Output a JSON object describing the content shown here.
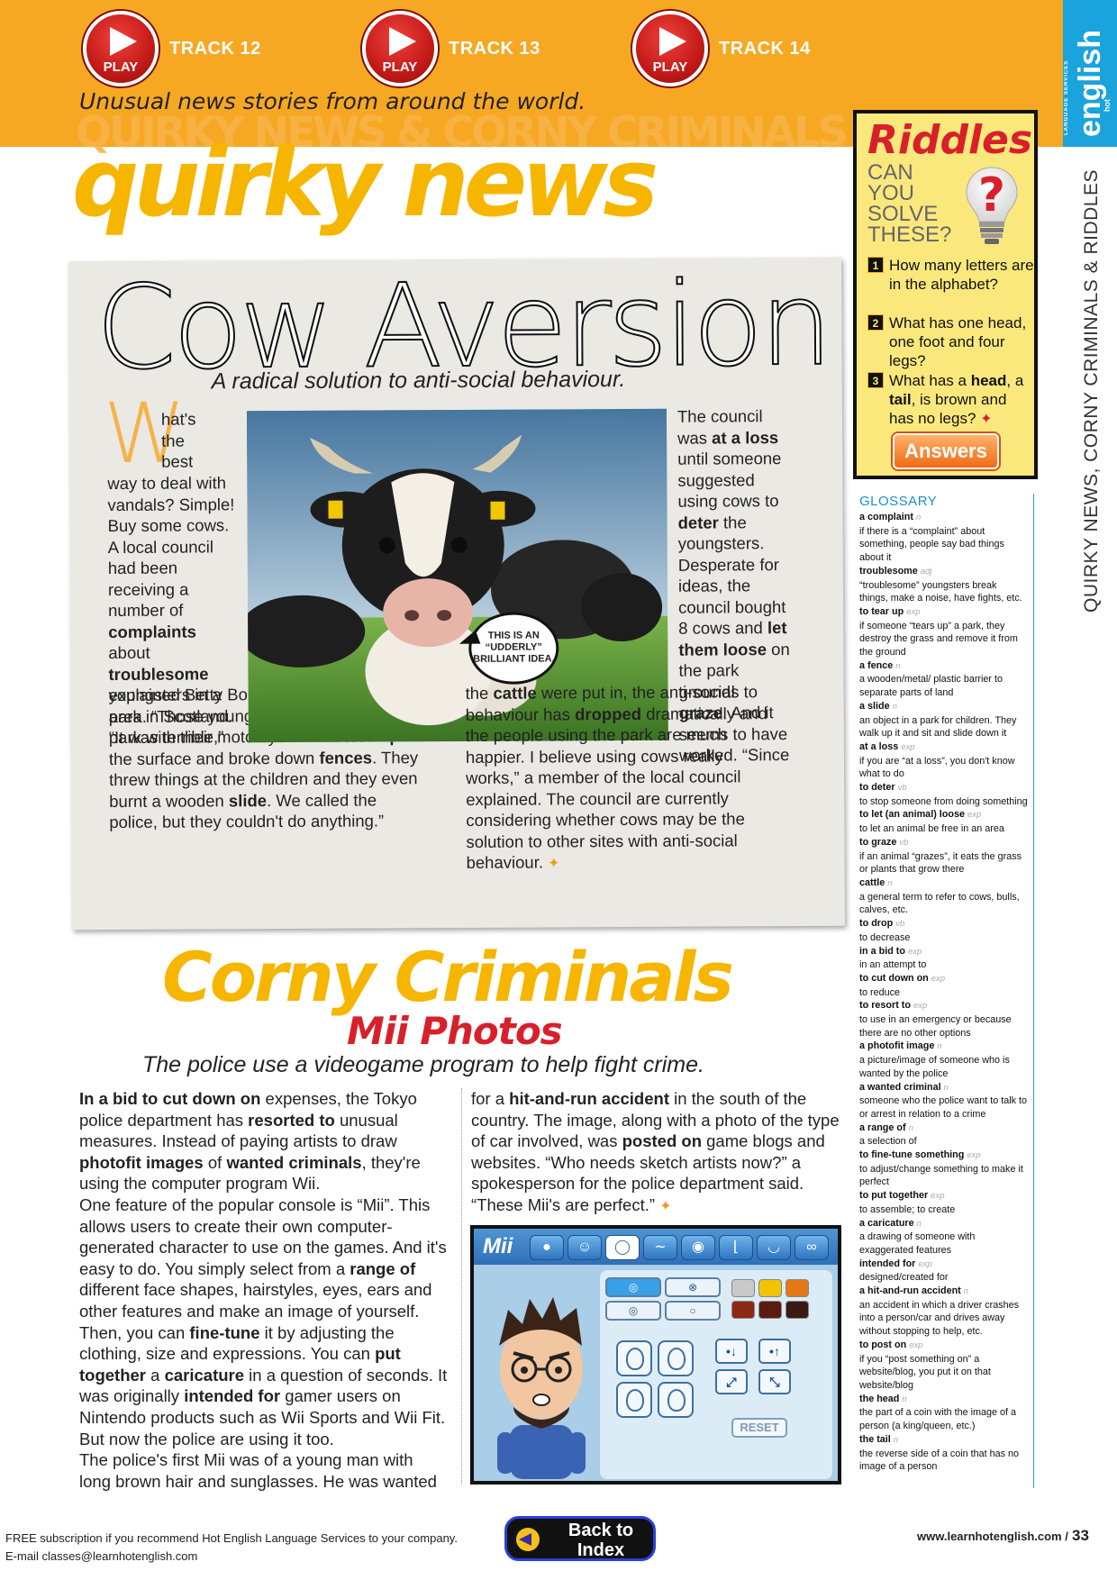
{
  "header": {
    "tracks": [
      {
        "play_label": "PLAY",
        "label": "TRACK 12"
      },
      {
        "play_label": "PLAY",
        "label": "TRACK 13"
      },
      {
        "play_label": "PLAY",
        "label": "TRACK 14"
      }
    ],
    "tagline": "Unusual news stories from around the world.",
    "ghost_title": "QUIRKY NEWS & CORNY CRIMINALS",
    "quirky_title": "quirky news",
    "brand": {
      "hot": "hot",
      "name": "english",
      "sub": "LANGUAGE SERVICES"
    }
  },
  "side_label": "QUIRKY NEWS, CORNY CRIMINALS & RIDDLES",
  "riddles": {
    "title": "Riddles",
    "prompt": "CAN YOU SOLVE THESE?",
    "questions": [
      {
        "num": "1",
        "text": "How many letters are in the alphabet?"
      },
      {
        "num": "2",
        "text": "What has one head, one foot and four legs?"
      },
      {
        "num": "3",
        "text_before": "What has a ",
        "bold1": "head",
        "mid": ", a ",
        "bold2": "tail",
        "text_after": ", is brown and has no legs?"
      }
    ],
    "answers_label": "Answers"
  },
  "cow_article": {
    "title": "Cow Aversion",
    "subtitle": "A radical solution to anti-social behaviour.",
    "drop_cap": "W",
    "col1_top": [
      "hat's",
      "the",
      "best"
    ],
    "col1_a": "way to deal with vandals? Simple! Buy some cows. A local council had been receiving a number of ",
    "b_complaints": "complaints",
    "col1_b": " about ",
    "b_troublesome": "troublesome",
    "col1_c": " youngsters in a park in Scotland. “It was terrible,”",
    "col1_d": "explained Betty Booth, a resident from the area. “Those young kids rode onto the park with their motorcycles and ",
    "b_tore_up": "tore up",
    "col1_e": " the surface and broke down ",
    "b_fences": "fences",
    "col1_f": ". They threw things at the children and they even burnt a wooden ",
    "b_slide": "slide",
    "col1_g": ". We called the police, but they couldn't do anything.”",
    "col2_a": "The council was ",
    "b_at_a_loss": "at a loss",
    "col2_b": " until someone suggested using cows to ",
    "b_deter": "deter",
    "col2_c": " the youngsters. Desperate for ideas, the council bought 8 cows and ",
    "b_let_loose": "let them loose",
    "col2_d": " on the park grounds to ",
    "b_graze": "graze",
    "col2_e": ". And it seems to have worked. “Since",
    "col3_a": "the ",
    "b_cattle": "cattle",
    "col3_b": " were put in, the anti-social behaviour has ",
    "b_dropped": "dropped",
    "col3_c": " dramatically and the people using the park are much happier. I believe using cows really works,” a member of the local council explained. The council are currently considering whether cows may be the solution to other sites with anti-social behaviour.",
    "speech_bubble": "THIS IS AN “UDDERLY” BRILLIANT IDEA."
  },
  "corny": {
    "title": "Corny Criminals",
    "subtitle": "Mii Photos",
    "standfirst": "The police use a videogame program to help fight crime.",
    "c1_b1": "In a bid to cut down on",
    "c1_t1": " expenses, the Tokyo police department has ",
    "c1_b2": "resorted to",
    "c1_t2": " unusual measures. Instead of paying artists to draw ",
    "c1_b3": "photofit images",
    "c1_t3": " of ",
    "c1_b4": "wanted criminals",
    "c1_t4": ", they're using the computer program Wii.",
    "c1_p2a": "One feature of the popular console is “Mii”. This allows users to create their own computer-generated character to use on the games. And it's easy to do. You simply select from a ",
    "c1_b5": "range of",
    "c1_p2b": " different face shapes, hairstyles, eyes, ears and other features and make an image of yourself. Then, you can ",
    "c1_b6": "fine-tune",
    "c1_p2c": " it by adjusting the clothing, size and expressions. You can ",
    "c1_b7": "put together",
    "c1_p2d": " a ",
    "c1_b8": "caricature",
    "c1_p2e": " in a question of seconds. It was originally ",
    "c1_b9": "intended for",
    "c1_p2f": " gamer users on Nintendo products such as Wii Sports and Wii Fit. But now the police are using it too.",
    "c1_p3": "The police's first Mii was of a young man with long brown hair and sunglasses. He was wanted",
    "c2_t1": "for a ",
    "c2_b1": "hit-and-run accident",
    "c2_t2": " in the south of the country. The image, along with a photo of the type of car involved, was ",
    "c2_b2": "posted on",
    "c2_t3": " game blogs and websites. “Who needs sketch artists now?” a spokesperson for the police department said. “These Mii's are perfect.”"
  },
  "mii_screen": {
    "logo": "Mii",
    "reset": "RESET"
  },
  "glossary": {
    "title": "GLOSSARY",
    "items": [
      {
        "term": "a complaint",
        "pos": "n",
        "def": "if there is a “complaint” about something, people say bad things about it"
      },
      {
        "term": "troublesome",
        "pos": "adj",
        "def": "“troublesome” youngsters break things, make a noise, have fights, etc."
      },
      {
        "term": "to tear up",
        "pos": "exp",
        "def": "if someone “tears up” a park, they destroy the grass and remove it from the ground"
      },
      {
        "term": "a fence",
        "pos": "n",
        "def": "a wooden/metal/ plastic barrier to separate parts of land"
      },
      {
        "term": "a slide",
        "pos": "n",
        "def": "an object in a park for children. They walk up it and sit and slide down it"
      },
      {
        "term": "at a loss",
        "pos": "exp",
        "def": "if you are “at a loss”, you don't know what to do"
      },
      {
        "term": "to deter",
        "pos": "vb",
        "def": "to stop someone from doing something"
      },
      {
        "term": "to let (an animal) loose",
        "pos": "exp",
        "def": "to let an animal be free in an area"
      },
      {
        "term": "to graze",
        "pos": "vb",
        "def": "if an animal “grazes”, it eats the grass or plants that grow there"
      },
      {
        "term": "cattle",
        "pos": "n",
        "def": "a general term to refer to cows, bulls, calves, etc."
      },
      {
        "term": "to drop",
        "pos": "vb",
        "def": "to decrease"
      },
      {
        "term": "in a bid to",
        "pos": "exp",
        "def": "in an attempt to"
      },
      {
        "term": "to cut down on",
        "pos": "exp",
        "def": "to reduce"
      },
      {
        "term": "to resort to",
        "pos": "exp",
        "def": "to use in an emergency or because there are no other options"
      },
      {
        "term": "a photofit image",
        "pos": "n",
        "def": "a picture/image of someone who is wanted by the police"
      },
      {
        "term": "a wanted criminal",
        "pos": "n",
        "def": "someone who the police want to talk to or arrest in relation to a crime"
      },
      {
        "term": "a range of",
        "pos": "n",
        "def": "a selection of"
      },
      {
        "term": "to fine-tune something",
        "pos": "exp",
        "def": "to adjust/change something to make it perfect"
      },
      {
        "term": "to put together",
        "pos": "exp",
        "def": "to assemble; to create"
      },
      {
        "term": "a caricature",
        "pos": "n",
        "def": "a drawing of someone with exaggerated features"
      },
      {
        "term": "intended for",
        "pos": "exp",
        "def": "designed/created for"
      },
      {
        "term": "a hit-and-run accident",
        "pos": "n",
        "def": "an accident in which a driver crashes into a person/car and drives away without stopping to help, etc."
      },
      {
        "term": "to post on",
        "pos": "exp",
        "def": "if you “post something on” a website/blog, you put it on that website/blog"
      },
      {
        "term": "the head",
        "pos": "n",
        "def": "the part of a coin with the image of a person (a king/queen, etc.)"
      },
      {
        "term": "the tail",
        "pos": "n",
        "def": "the reverse side of a coin that has no image of a person"
      }
    ]
  },
  "footer": {
    "line1": "FREE subscription if you recommend Hot English Language Services to your company.",
    "line2": "E-mail classes@learnhotenglish.com",
    "back_line1": "Back to",
    "back_line2": "Index",
    "site": "www.learnhotenglish.com /",
    "page": "33"
  },
  "colors": {
    "header_orange": "#f7a823",
    "brand_blue": "#1aa3dc",
    "title_yellow": "#f6b600",
    "riddle_red": "#d8202a"
  }
}
